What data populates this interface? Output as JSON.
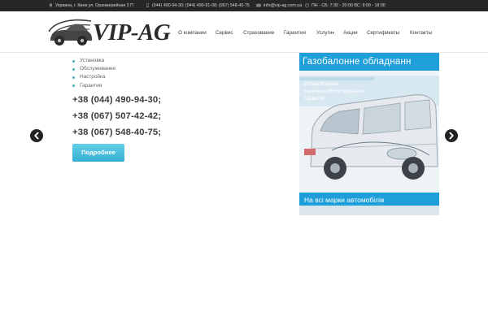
{
  "topbar": {
    "address": "Украина, г. Киев ул. Оранжерейная 3 П",
    "phones": "(044) 490-94-30; (044) 490-91-08; (067) 548-40-75",
    "email": "info@vip-ag.com.ua",
    "hours": "ПН - СБ: 7:30 - 20:00 ВС: 9:00 - 18:00"
  },
  "logo": {
    "text": "VIP-AG"
  },
  "nav": {
    "items": [
      {
        "label": "О компании"
      },
      {
        "label": "Сервис"
      },
      {
        "label": "Страхование"
      },
      {
        "label": "Гарантия"
      },
      {
        "label": "Услуги",
        "dropdown": true
      },
      {
        "label": "Акции"
      },
      {
        "label": "Сертификаты"
      },
      {
        "label": "Контакты"
      }
    ]
  },
  "slide": {
    "bullets": [
      "Установка",
      "Обслуживание",
      "Настройка",
      "Гарантия"
    ],
    "phones": [
      "+38 (044) 490-94-30;",
      "+38 (067) 507-42-42;",
      "+38 (067) 548-40-75;"
    ],
    "button_label": "Подробнее"
  },
  "promo": {
    "title": "Газобалонне обладнанн",
    "lines": [
      "встановлення",
      "технічне обслуговування",
      "гарантія"
    ],
    "bottom_text": "На всі марки автомобілів"
  },
  "colors": {
    "topbar_bg": "#262626",
    "accent": "#4aa9c3",
    "button_bg": "#45bddd",
    "arrow_bg": "#222222"
  },
  "icons": {
    "slider_prev": "chevron-left-icon",
    "slider_next": "chevron-right-icon"
  }
}
